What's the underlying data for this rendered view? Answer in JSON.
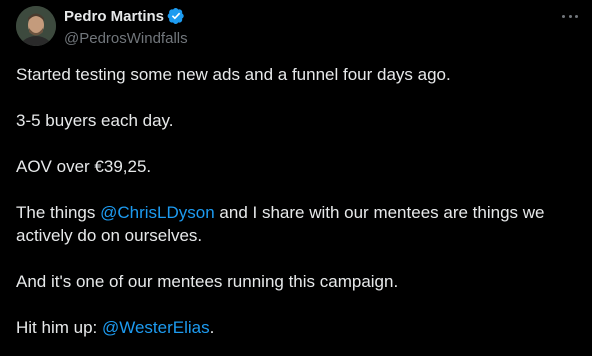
{
  "author": {
    "display_name": "Pedro Martins",
    "handle": "@PedrosWindfalls",
    "verified_icon": "verified-badge-icon",
    "verified_color": "#1d9bf0"
  },
  "more_icon": "more-horizontal-icon",
  "colors": {
    "background": "#000000",
    "text": "#e7e9ea",
    "secondary": "#71767b",
    "link": "#1d9bf0"
  },
  "tweet": {
    "p1": "Started testing some new ads and a funnel four days ago.",
    "p2": "3-5 buyers each day.",
    "p3": "AOV over €39,25.",
    "p4_pre": "The things ",
    "p4_mention": "@ChrisLDyson",
    "p4_post": " and I share with our mentees are things we actively do on ourselves.",
    "p5": "And it's one of our mentees running this campaign.",
    "p6_pre": "Hit him up: ",
    "p6_mention": "@WesterElias",
    "p6_post": "."
  }
}
